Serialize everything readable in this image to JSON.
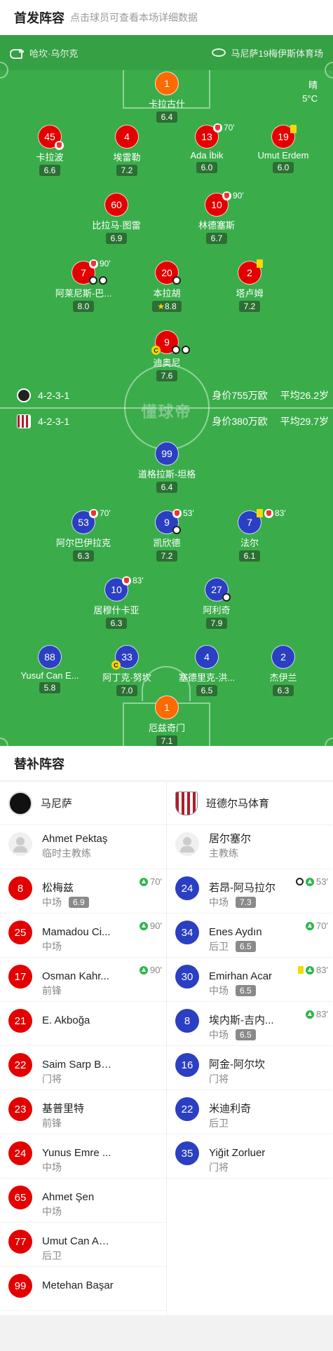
{
  "header": {
    "title": "首发阵容",
    "hint": "点击球员可查看本场详细数据"
  },
  "match_info": {
    "referee": "哈坎·乌尔克",
    "stadium": "马尼萨19梅伊斯体育场",
    "weather": "晴",
    "temperature": "5°C",
    "watermark": "懂球帝"
  },
  "home": {
    "formation": "4-2-3-1",
    "value": "身价755万欧",
    "age": "平均26.2岁"
  },
  "away": {
    "formation": "4-2-3-1",
    "value": "身价380万欧",
    "age": "平均29.7岁"
  },
  "home_players": [
    {
      "number": "1",
      "name": "卡拉古什",
      "rating": "6.4"
    },
    {
      "number": "45",
      "name": "卡拉波",
      "rating": "6.6"
    },
    {
      "number": "4",
      "name": "埃雷勒",
      "rating": "7.2"
    },
    {
      "number": "13",
      "name": "Ada İbik",
      "rating": "6.0",
      "event": "70'"
    },
    {
      "number": "19",
      "name": "Umut Erdem",
      "rating": "6.0"
    },
    {
      "number": "60",
      "name": "比拉马·图雷",
      "rating": "6.9"
    },
    {
      "number": "10",
      "name": "林德塞斯",
      "rating": "6.7",
      "event": "90'"
    },
    {
      "number": "7",
      "name": "阿莱尼斯-巴...",
      "rating": "8.0",
      "event": "90'"
    },
    {
      "number": "20",
      "name": "本拉胡",
      "rating": "8.8"
    },
    {
      "number": "2",
      "name": "塔卢姆",
      "rating": "7.2"
    },
    {
      "number": "9",
      "name": "迪奥尼",
      "rating": "7.6"
    }
  ],
  "away_players": [
    {
      "number": "99",
      "name": "道格拉斯-坦格",
      "rating": "6.4"
    },
    {
      "number": "53",
      "name": "阿尔巴伊拉克",
      "rating": "6.3",
      "event": "70'"
    },
    {
      "number": "9",
      "name": "凯欣德",
      "rating": "7.2",
      "event": "53'"
    },
    {
      "number": "7",
      "name": "法尔",
      "rating": "6.1",
      "event": "83'"
    },
    {
      "number": "10",
      "name": "居穆什卡亚",
      "rating": "6.3",
      "event": "83'"
    },
    {
      "number": "27",
      "name": "阿利奇",
      "rating": "7.9"
    },
    {
      "number": "88",
      "name": "Yusuf Can E...",
      "rating": "5.8"
    },
    {
      "number": "33",
      "name": "阿丁克·努坎",
      "rating": "7.0"
    },
    {
      "number": "4",
      "name": "塞德里克-洪...",
      "rating": "6.5"
    },
    {
      "number": "2",
      "name": "杰伊兰",
      "rating": "6.3"
    },
    {
      "number": "1",
      "name": "厄兹奇门",
      "rating": "7.1"
    }
  ],
  "subs_title": "替补阵容",
  "home_subs": {
    "team": "马尼萨",
    "coach": {
      "name": "Ahmet Pektaş",
      "role": "临时主教练"
    },
    "players": [
      {
        "number": "8",
        "name": "松梅兹",
        "pos": "中场",
        "rating": "6.9",
        "event": "70'"
      },
      {
        "number": "25",
        "name": "Mamadou Ci...",
        "pos": "中场",
        "event": "90'"
      },
      {
        "number": "17",
        "name": "Osman Kahr...",
        "pos": "前锋",
        "event": "90'"
      },
      {
        "number": "21",
        "name": "E. Akboğa",
        "pos": ""
      },
      {
        "number": "22",
        "name": "Saim Sarp Bo...",
        "pos": "门将"
      },
      {
        "number": "23",
        "name": "基普里特",
        "pos": "前锋"
      },
      {
        "number": "24",
        "name": "Yunus Emre ...",
        "pos": "中场"
      },
      {
        "number": "65",
        "name": "Ahmet Şen",
        "pos": "中场"
      },
      {
        "number": "77",
        "name": "Umut Can Asl...",
        "pos": "后卫"
      },
      {
        "number": "99",
        "name": "Metehan Başar",
        "pos": ""
      }
    ]
  },
  "away_subs": {
    "team": "班德尔马体育",
    "coach": {
      "name": "居尔塞尔",
      "role": "主教练"
    },
    "players": [
      {
        "number": "24",
        "name": "若昂-阿马拉尔",
        "pos": "中场",
        "rating": "7.3",
        "event": "53'"
      },
      {
        "number": "34",
        "name": "Enes Aydın",
        "pos": "后卫",
        "rating": "6.5",
        "event": "70'"
      },
      {
        "number": "30",
        "name": "Emirhan Acar",
        "pos": "中场",
        "rating": "6.5",
        "event": "83'"
      },
      {
        "number": "8",
        "name": "埃内斯-吉内...",
        "pos": "中场",
        "rating": "6.5",
        "event": "83'"
      },
      {
        "number": "16",
        "name": "阿金-阿尔坎",
        "pos": "门将"
      },
      {
        "number": "22",
        "name": "米迪利奇",
        "pos": "后卫"
      },
      {
        "number": "35",
        "name": "Yiğit Zorluer",
        "pos": "门将"
      }
    ]
  },
  "colors": {
    "pitch": "#3aad4a",
    "home": "#e30000",
    "away": "#2b3fc3",
    "goalkeeper": "#ff6a00"
  },
  "icons": [
    "whistle-icon",
    "stadium-icon",
    "substitution-icon",
    "goal-ball-icon",
    "yellow-card-icon",
    "captain-icon",
    "star-icon",
    "sub-in-icon"
  ]
}
